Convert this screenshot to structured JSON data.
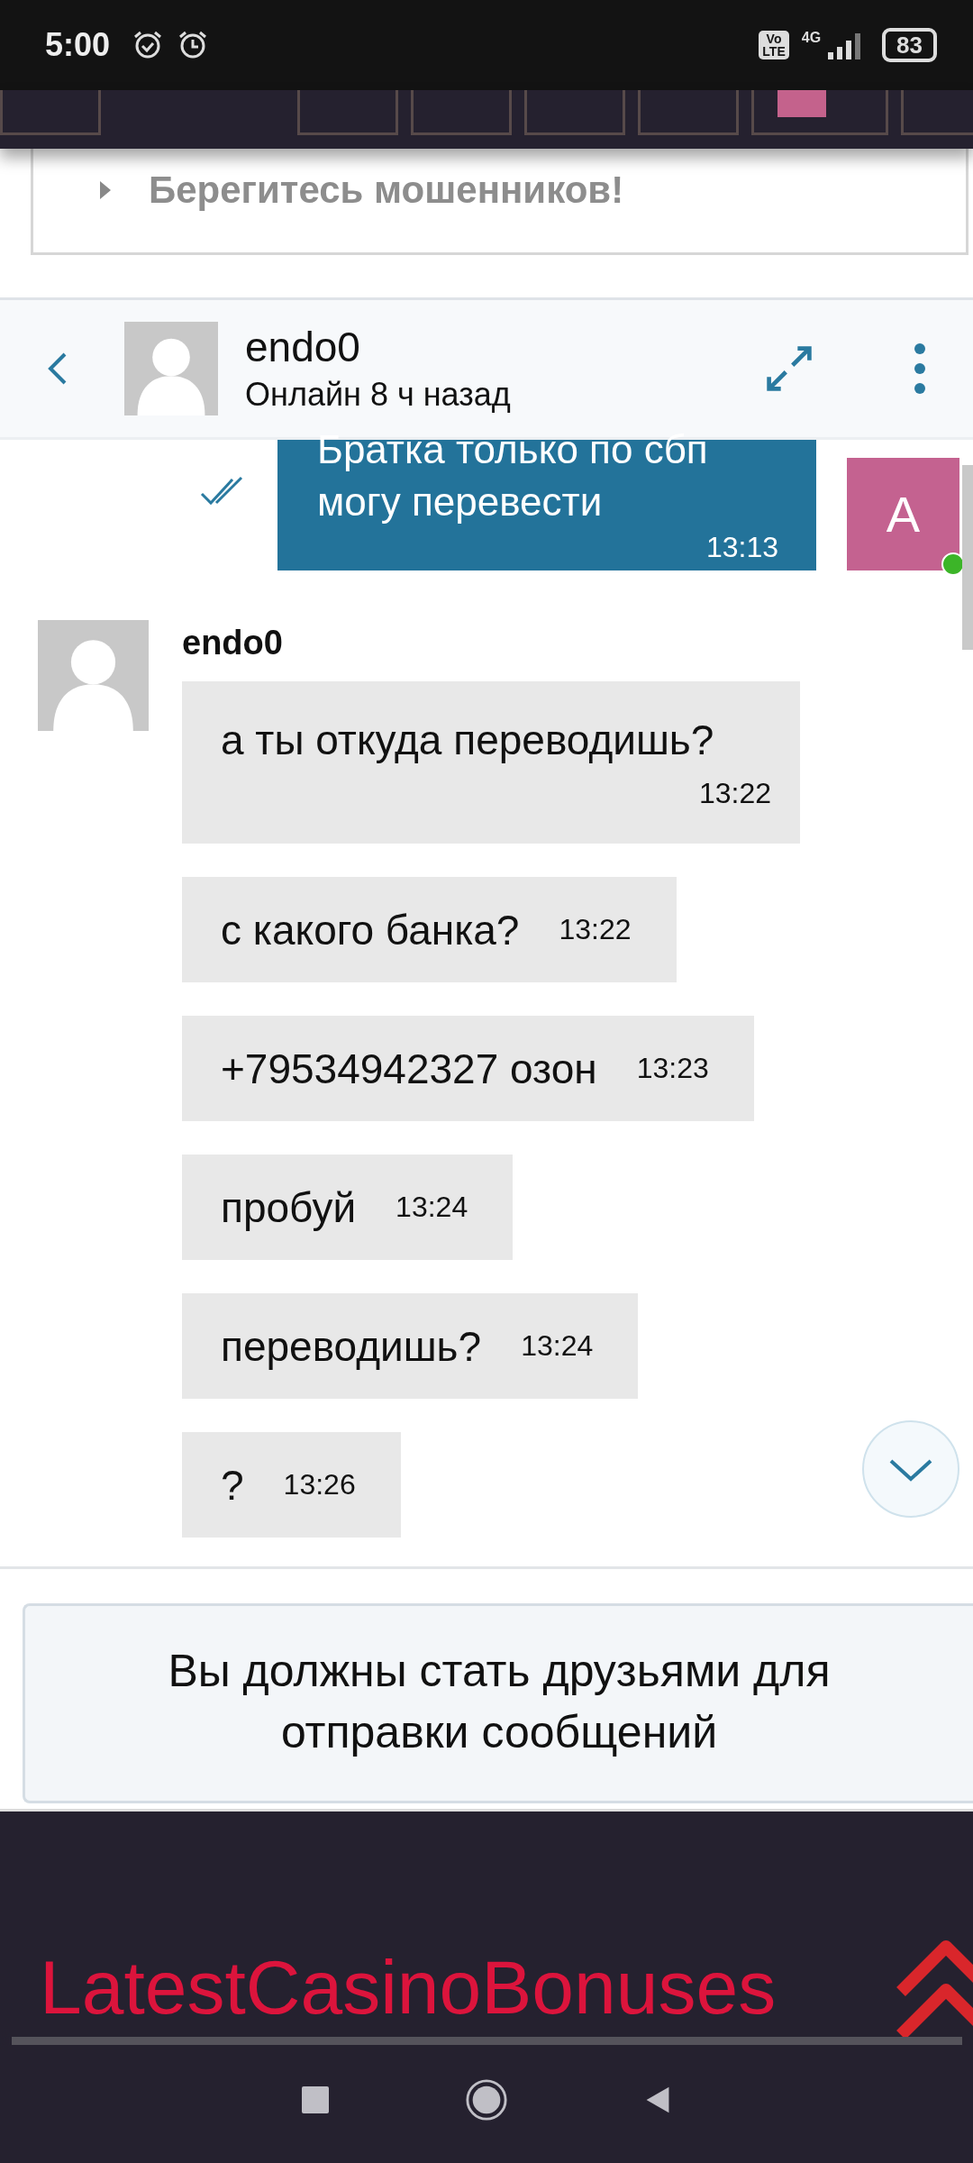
{
  "status_bar": {
    "time": "5:00",
    "volte_top": "Vo",
    "volte_bottom": "LTE",
    "network": "4G",
    "battery": "83"
  },
  "top_nav": {
    "tiles": [
      {
        "kind": "plain"
      },
      {
        "kind": "gap"
      },
      {
        "kind": "plain"
      },
      {
        "kind": "plain"
      },
      {
        "kind": "plain"
      },
      {
        "kind": "plain"
      },
      {
        "kind": "swatch",
        "color": "#c4628c"
      },
      {
        "kind": "plain"
      }
    ]
  },
  "warning": {
    "text": "Берегитесь мошенников!",
    "expanded": false
  },
  "chat_header": {
    "name": "endo0",
    "status": "Онлайн 8 ч назад"
  },
  "sent_messages": [
    {
      "text": "Братка только по сбп могу перевести",
      "time": "13:13",
      "read": true,
      "avatar_letter": "А",
      "online": true
    }
  ],
  "received": {
    "name": "endo0",
    "messages": [
      {
        "text": "а ты откуда переводишь?",
        "time": "13:22",
        "wrap_time": true
      },
      {
        "text": "с какого банка?",
        "time": "13:22",
        "wrap_time": false
      },
      {
        "text": "+79534942327 озон",
        "time": "13:23",
        "wrap_time": false
      },
      {
        "text": "пробуй",
        "time": "13:24",
        "wrap_time": false
      },
      {
        "text": "переводишь?",
        "time": "13:24",
        "wrap_time": false
      },
      {
        "text": "?",
        "time": "13:26",
        "wrap_time": false
      }
    ]
  },
  "notice": "Вы должны стать друзьями для отправки сообщений",
  "footer": {
    "logo": "LatestCasinoBonuses"
  }
}
